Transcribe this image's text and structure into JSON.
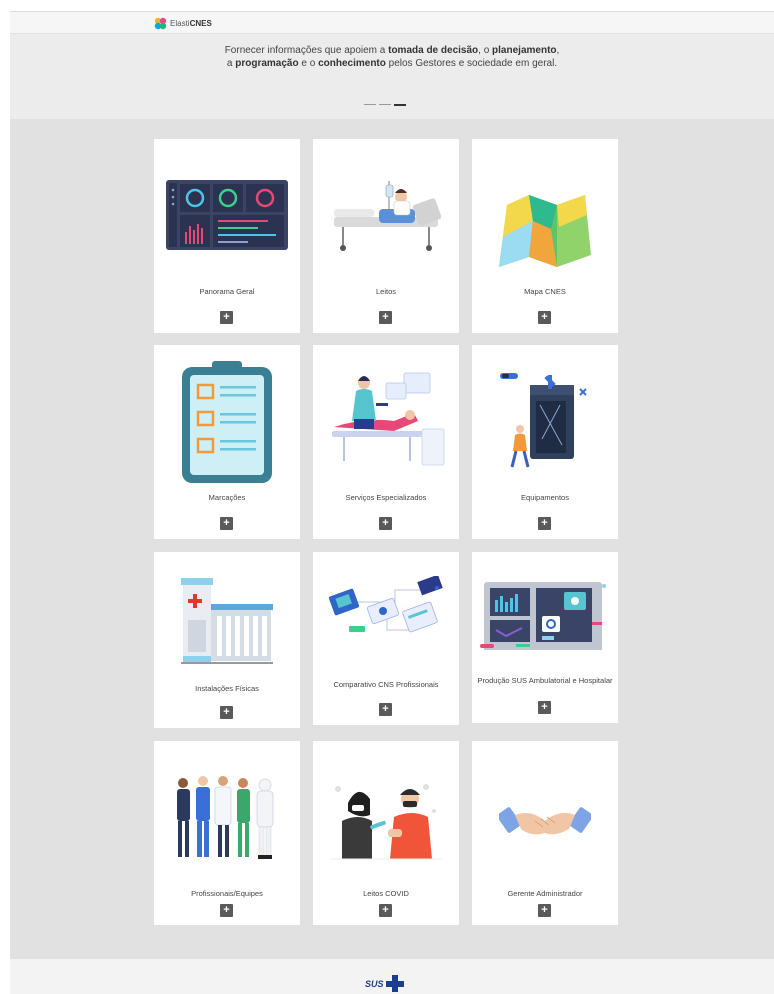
{
  "header": {
    "logo_prefix": "Elasti",
    "logo_suffix": "CNES"
  },
  "hero": {
    "line1": [
      "Fornecer informações que apoiem a ",
      "tomada de decisão",
      ", o ",
      "planejamento",
      ","
    ],
    "line2": [
      "a ",
      "programação",
      " e o ",
      "conhecimento",
      " pelos Gestores e sociedade em geral."
    ]
  },
  "cards": [
    {
      "title": "Panorama Geral",
      "icon": "dashboard-icon"
    },
    {
      "title": "Leitos",
      "icon": "hospital-bed-icon"
    },
    {
      "title": "Mapa CNES",
      "icon": "map-icon"
    },
    {
      "title": "Marcações",
      "icon": "clipboard-icon"
    },
    {
      "title": "Serviços Especializados",
      "icon": "medical-exam-icon"
    },
    {
      "title": "Equipamentos",
      "icon": "equipment-cabinet-icon"
    },
    {
      "title": "Instalações Físicas",
      "icon": "hospital-building-icon"
    },
    {
      "title": "Comparativo CNS Profissionais",
      "icon": "network-devices-icon"
    },
    {
      "title": "Produção SUS Ambulatorial e Hospitalar",
      "icon": "production-dashboard-icon"
    },
    {
      "title": "Profissionais/Equipes",
      "icon": "health-team-icon"
    },
    {
      "title": "Leitos COVID",
      "icon": "vaccination-icon"
    },
    {
      "title": "Gerente Administrador",
      "icon": "handshake-icon"
    }
  ],
  "expand_symbol": "+",
  "footer": {
    "brand": "SUS"
  }
}
